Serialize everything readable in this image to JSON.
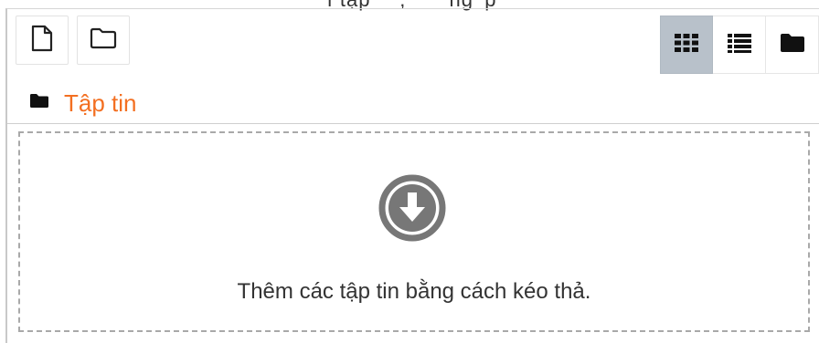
{
  "header": {
    "cut_off_text": "'ì  tập  '   '   ,  ' ` ̈  'ng  'p"
  },
  "toolbar": {
    "add_file_icon": "file-icon",
    "create_folder_icon": "folder-icon",
    "view_icons": {
      "thumbnails": "grid-icon",
      "list": "list-icon",
      "tree": "folder-solid-icon"
    },
    "active_view": "thumbnails"
  },
  "path": {
    "icon": "folder-solid-icon",
    "label": "Tập tin"
  },
  "dropzone": {
    "icon": "download-circle-icon",
    "message": "Thêm các tập tin bằng cách kéo thả."
  },
  "colors": {
    "path_label": "#f36f21",
    "active_view_bg": "#b8c1ca",
    "icon_gray": "#777777"
  }
}
